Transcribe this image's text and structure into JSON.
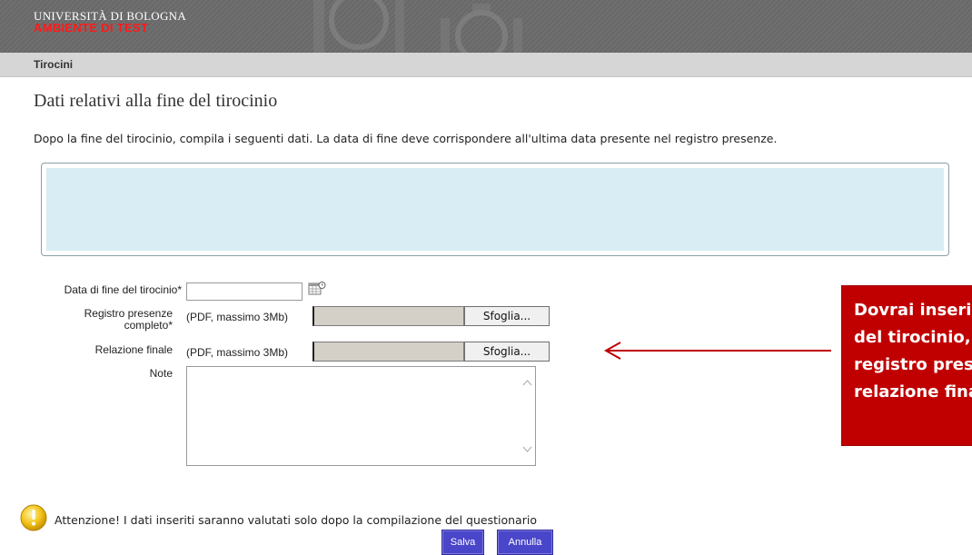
{
  "header": {
    "university": "UNIVERSITÀ DI BOLOGNA",
    "environment": "AMBIENTE DI TEST"
  },
  "breadcrumb": "Tirocini",
  "page": {
    "title": "Dati relativi alla fine del tirocinio",
    "intro": "Dopo la fine del tirocinio, compila i seguenti dati. La data di fine deve corrispondere all'ultima data presente nel registro presenze."
  },
  "form": {
    "end_date_label": "Data di fine del tirocinio*",
    "end_date_value": "",
    "register_label_line1": "Registro presenze",
    "register_label_line2": "completo*",
    "register_hint": "(PDF, massimo 3Mb)",
    "report_label": "Relazione finale",
    "report_hint": "(PDF, massimo 3Mb)",
    "browse_label": "Sfoglia...",
    "notes_label": "Note",
    "notes_value": ""
  },
  "warning": "Attenzione! I dati inseriti saranno valutati solo dopo la compilazione del questionario",
  "buttons": {
    "save": "Salva",
    "cancel": "Annulla"
  },
  "callout": {
    "text": "Dovrai inserire la data di fine\ndel tirocinio, caricare il\nregistro presenze e la\nrelazione finale"
  },
  "icons": {
    "calendar": "calendar-icon",
    "warning": "warning-icon",
    "arrow": "arrow-left-icon"
  },
  "colors": {
    "header_bg": "#6b6b6b",
    "environment": "#ff1a1a",
    "info_box": "#d9edf4",
    "buttons": "#4a46c9",
    "callout": "#c00000"
  }
}
